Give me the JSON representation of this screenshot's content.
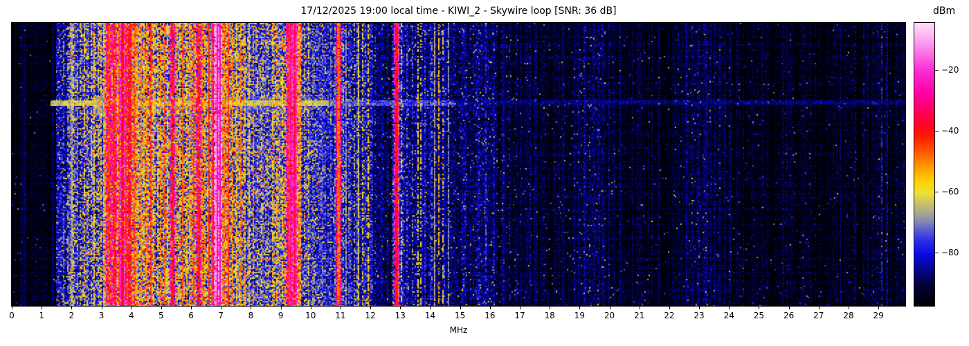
{
  "figure": {
    "title": "17/12/2025 19:00 local time - KIWI_2 - Skywire loop [SNR: 36 dB]",
    "xlabel": "MHz",
    "colorbar_label": "dBm"
  },
  "chart_data": {
    "type": "heatmap",
    "subtype": "radio-spectrogram-waterfall",
    "title": "17/12/2025 19:00 local time - KIWI_2 - Skywire loop [SNR: 36 dB]",
    "xlabel": "MHz",
    "ylabel": "",
    "x_range": [
      0,
      29.9
    ],
    "x_ticks": [
      0,
      1,
      2,
      3,
      4,
      5,
      6,
      7,
      8,
      9,
      10,
      11,
      12,
      13,
      14,
      15,
      16,
      17,
      18,
      19,
      20,
      21,
      22,
      23,
      24,
      25,
      26,
      27,
      28,
      29
    ],
    "grid": false,
    "colorbar": {
      "label": "dBm",
      "ticks": [
        -20,
        -40,
        -60,
        -80
      ],
      "vmin": -97.5,
      "vmax": -4.5,
      "position": "right"
    },
    "colormap_stops": [
      [
        0.0,
        "#000000"
      ],
      [
        0.075,
        "#02023a"
      ],
      [
        0.13,
        "#05058f"
      ],
      [
        0.183,
        "#0a0ae0"
      ],
      [
        0.23,
        "#2a2ee6"
      ],
      [
        0.27,
        "#5b60cf"
      ],
      [
        0.295,
        "#8286b4"
      ],
      [
        0.33,
        "#aaa78e"
      ],
      [
        0.37,
        "#d2c75f"
      ],
      [
        0.4,
        "#eee032"
      ],
      [
        0.44,
        "#fdd105"
      ],
      [
        0.49,
        "#ff9b00"
      ],
      [
        0.54,
        "#ff5d00"
      ],
      [
        0.6,
        "#ff1800"
      ],
      [
        0.64,
        "#ff0426"
      ],
      [
        0.69,
        "#ff005e"
      ],
      [
        0.75,
        "#ff00a6"
      ],
      [
        0.83,
        "#fb2bd3"
      ],
      [
        0.9,
        "#fc7ae8"
      ],
      [
        0.97,
        "#fec5f5"
      ],
      [
        1.0,
        "#ffddfc"
      ]
    ],
    "noise_regions": [
      [
        0.0,
        1.5,
        -95,
        2.5,
        0.03
      ],
      [
        1.5,
        1.85,
        -84,
        6,
        0.35
      ],
      [
        1.85,
        2.1,
        -80,
        7,
        0.45
      ],
      [
        2.1,
        3.07,
        -78,
        8,
        0.5
      ],
      [
        3.07,
        3.58,
        -64,
        10,
        0.8
      ],
      [
        3.58,
        4.23,
        -58,
        11,
        0.85
      ],
      [
        4.23,
        4.74,
        -64,
        11,
        0.8
      ],
      [
        4.74,
        5.66,
        -70,
        11,
        0.65
      ],
      [
        5.66,
        6.59,
        -68,
        11,
        0.7
      ],
      [
        6.59,
        7.24,
        -62,
        11,
        0.8
      ],
      [
        7.24,
        7.82,
        -70,
        10,
        0.6
      ],
      [
        7.82,
        8.74,
        -76,
        8,
        0.45
      ],
      [
        8.74,
        9.2,
        -74,
        9,
        0.5
      ],
      [
        9.2,
        9.66,
        -58,
        10,
        0.85
      ],
      [
        9.66,
        10.24,
        -78,
        7,
        0.4
      ],
      [
        10.24,
        11.17,
        -79,
        6,
        0.35
      ],
      [
        11.17,
        12.1,
        -82,
        6,
        0.3
      ],
      [
        12.1,
        12.72,
        -89,
        4,
        0.12
      ],
      [
        12.72,
        13.14,
        -82,
        6,
        0.3
      ],
      [
        13.14,
        14.41,
        -86,
        5,
        0.2
      ],
      [
        14.41,
        14.99,
        -89,
        4,
        0.15
      ],
      [
        14.99,
        16.26,
        -88,
        4.5,
        0.18
      ],
      [
        16.26,
        16.96,
        -91,
        3.5,
        0.1
      ],
      [
        16.96,
        19.04,
        -93,
        3,
        0.07
      ],
      [
        19.04,
        19.85,
        -90,
        4,
        0.12
      ],
      [
        19.85,
        22.28,
        -94,
        3,
        0.05
      ],
      [
        22.28,
        24.13,
        -92,
        3.5,
        0.08
      ],
      [
        24.13,
        29.9,
        -94,
        3,
        0.05
      ]
    ],
    "carrier_lines": [
      [
        1.71,
        -72,
        0.5,
        1
      ],
      [
        1.84,
        -66,
        0.4,
        1
      ],
      [
        1.93,
        -74,
        0.5,
        1
      ],
      [
        2.0,
        -66,
        0.9,
        1
      ],
      [
        2.06,
        -60,
        0.35,
        1
      ],
      [
        2.17,
        -70,
        0.45,
        1
      ],
      [
        2.28,
        -64,
        0.4,
        1
      ],
      [
        2.4,
        -58,
        0.5,
        1
      ],
      [
        2.52,
        -68,
        0.45,
        1
      ],
      [
        2.63,
        -62,
        0.5,
        1
      ],
      [
        2.74,
        -58,
        0.55,
        1
      ],
      [
        2.85,
        -64,
        0.5,
        1
      ],
      [
        2.96,
        -56,
        0.55,
        1
      ],
      [
        3.08,
        -60,
        0.6,
        1
      ],
      [
        3.2,
        -44,
        0.85,
        2
      ],
      [
        3.3,
        -52,
        0.7,
        1
      ],
      [
        3.38,
        -42,
        0.9,
        2
      ],
      [
        3.48,
        -55,
        0.75,
        1
      ],
      [
        3.56,
        -46,
        0.85,
        1
      ],
      [
        3.64,
        -38,
        0.95,
        2
      ],
      [
        3.73,
        -50,
        0.8,
        1
      ],
      [
        3.82,
        -44,
        0.9,
        1
      ],
      [
        3.91,
        -40,
        0.9,
        2
      ],
      [
        4.0,
        -52,
        0.75,
        1
      ],
      [
        4.08,
        -47,
        0.85,
        1
      ],
      [
        4.18,
        -55,
        0.7,
        1
      ],
      [
        4.29,
        -50,
        0.8,
        1
      ],
      [
        4.4,
        -58,
        0.65,
        1
      ],
      [
        4.51,
        -53,
        0.7,
        1
      ],
      [
        4.62,
        -44,
        0.85,
        1
      ],
      [
        4.73,
        -56,
        0.65,
        1
      ],
      [
        4.85,
        -60,
        0.6,
        1
      ],
      [
        4.97,
        -52,
        0.7,
        1
      ],
      [
        5.09,
        -47,
        0.8,
        1
      ],
      [
        5.21,
        -58,
        0.6,
        1
      ],
      [
        5.33,
        -41,
        0.9,
        2
      ],
      [
        5.46,
        -50,
        0.75,
        1
      ],
      [
        5.59,
        -56,
        0.6,
        1
      ],
      [
        5.71,
        -48,
        0.8,
        1
      ],
      [
        5.84,
        -58,
        0.6,
        1
      ],
      [
        5.95,
        -52,
        0.7,
        1
      ],
      [
        6.06,
        -46,
        0.85,
        1
      ],
      [
        6.19,
        -42,
        0.9,
        2
      ],
      [
        6.33,
        -50,
        0.75,
        1
      ],
      [
        6.46,
        -55,
        0.65,
        1
      ],
      [
        6.59,
        -43,
        0.85,
        1
      ],
      [
        6.7,
        -38,
        0.9,
        2
      ],
      [
        6.81,
        -28,
        1,
        2
      ],
      [
        6.89,
        -26,
        1,
        3
      ],
      [
        6.99,
        -42,
        0.9,
        1
      ],
      [
        7.11,
        -50,
        0.8,
        1
      ],
      [
        7.23,
        -44,
        0.85,
        1
      ],
      [
        7.36,
        -52,
        0.7,
        1
      ],
      [
        7.49,
        -58,
        0.6,
        1
      ],
      [
        7.63,
        -50,
        0.7,
        1
      ],
      [
        7.79,
        -55,
        0.6,
        1
      ],
      [
        7.93,
        -60,
        0.5,
        1
      ],
      [
        8.06,
        -52,
        0.6,
        1
      ],
      [
        8.21,
        -64,
        0.4,
        1
      ],
      [
        8.36,
        -60,
        0.45,
        1
      ],
      [
        8.53,
        -63,
        0.4,
        1
      ],
      [
        8.71,
        -58,
        0.5,
        1
      ],
      [
        8.86,
        -55,
        0.5,
        1
      ],
      [
        9.01,
        -58,
        0.5,
        1
      ],
      [
        9.11,
        -52,
        0.6,
        1
      ],
      [
        9.23,
        -42,
        0.9,
        2
      ],
      [
        9.32,
        -37,
        0.95,
        2
      ],
      [
        9.42,
        -36,
        0.95,
        2
      ],
      [
        9.51,
        -46,
        0.85,
        1
      ],
      [
        9.63,
        -56,
        0.6,
        1
      ],
      [
        9.79,
        -64,
        0.4,
        1
      ],
      [
        9.93,
        -60,
        0.45,
        1
      ],
      [
        10.12,
        -68,
        0.35,
        1
      ],
      [
        10.37,
        -72,
        0.3,
        1
      ],
      [
        10.64,
        -70,
        0.3,
        1
      ],
      [
        10.88,
        -48,
        0.95,
        2
      ],
      [
        11.05,
        -64,
        0.4,
        1
      ],
      [
        11.15,
        -70,
        0.8,
        1
      ],
      [
        11.27,
        -72,
        0.3,
        1
      ],
      [
        11.43,
        -66,
        0.4,
        1
      ],
      [
        11.58,
        -63,
        0.85,
        1
      ],
      [
        11.73,
        -60,
        0.5,
        1
      ],
      [
        11.92,
        -57,
        0.6,
        1
      ],
      [
        12.12,
        -76,
        0.3,
        1
      ],
      [
        12.37,
        -81,
        0.25,
        1
      ],
      [
        12.57,
        -79,
        0.25,
        1
      ],
      [
        12.81,
        -40,
        0.95,
        2
      ],
      [
        12.91,
        -54,
        0.7,
        1
      ],
      [
        13.01,
        -60,
        0.5,
        1
      ],
      [
        13.22,
        -73,
        0.3,
        1
      ],
      [
        13.4,
        -71,
        0.35,
        1
      ],
      [
        13.56,
        -58,
        0.55,
        1
      ],
      [
        13.65,
        -62,
        0.45,
        1
      ],
      [
        13.82,
        -76,
        0.3,
        1
      ],
      [
        14.02,
        -71,
        0.35,
        1
      ],
      [
        14.13,
        -68,
        0.9,
        1
      ],
      [
        14.26,
        -54,
        0.6,
        1
      ],
      [
        14.41,
        -63,
        0.45,
        1
      ],
      [
        14.57,
        -70,
        0.85,
        1
      ],
      [
        14.77,
        -81,
        0.3,
        1
      ],
      [
        15.02,
        -84,
        0.3,
        1
      ],
      [
        15.32,
        -83,
        0.3,
        1
      ],
      [
        15.62,
        -79,
        0.4,
        1
      ],
      [
        15.82,
        -77,
        0.5,
        1
      ],
      [
        16.12,
        -81,
        0.35,
        1
      ],
      [
        16.37,
        -83,
        0.3,
        1
      ],
      [
        16.64,
        -80,
        0.35,
        1
      ],
      [
        17.02,
        -87,
        0.25,
        1
      ],
      [
        17.34,
        -83,
        0.4,
        1
      ],
      [
        17.82,
        -88,
        0.2,
        1
      ],
      [
        18.42,
        -87,
        0.2,
        1
      ],
      [
        19.17,
        -84,
        0.35,
        1
      ],
      [
        19.42,
        -86,
        0.3,
        1
      ],
      [
        19.64,
        -85,
        0.3,
        1
      ],
      [
        20.12,
        -88,
        0.2,
        1
      ],
      [
        21.02,
        -89,
        0.15,
        1
      ],
      [
        22.52,
        -88,
        0.2,
        1
      ],
      [
        23.12,
        -87,
        0.2,
        1
      ],
      [
        24.02,
        -89,
        0.15,
        1
      ],
      [
        25.22,
        -89,
        0.15,
        1
      ],
      [
        26.42,
        -89,
        0.15,
        1
      ],
      [
        27.52,
        -88,
        0.18,
        1
      ],
      [
        28.22,
        -85,
        0.35,
        1
      ],
      [
        28.47,
        -86,
        0.3,
        1
      ],
      [
        29.07,
        -79,
        0.6,
        1
      ],
      [
        29.27,
        -84,
        0.35,
        1
      ]
    ],
    "horizontal_events": [
      [
        113,
        119,
        1.3,
        10.6,
        -64
      ],
      [
        107,
        127,
        3.45,
        10.0,
        -76
      ],
      [
        106,
        133,
        2.75,
        3.45,
        -70
      ],
      [
        113,
        119,
        10.6,
        14.8,
        -75
      ],
      [
        113,
        118,
        14.8,
        29.9,
        -87
      ],
      [
        140,
        145,
        8.5,
        11.5,
        -81
      ],
      [
        150,
        154,
        8.5,
        11.5,
        -83
      ]
    ]
  }
}
